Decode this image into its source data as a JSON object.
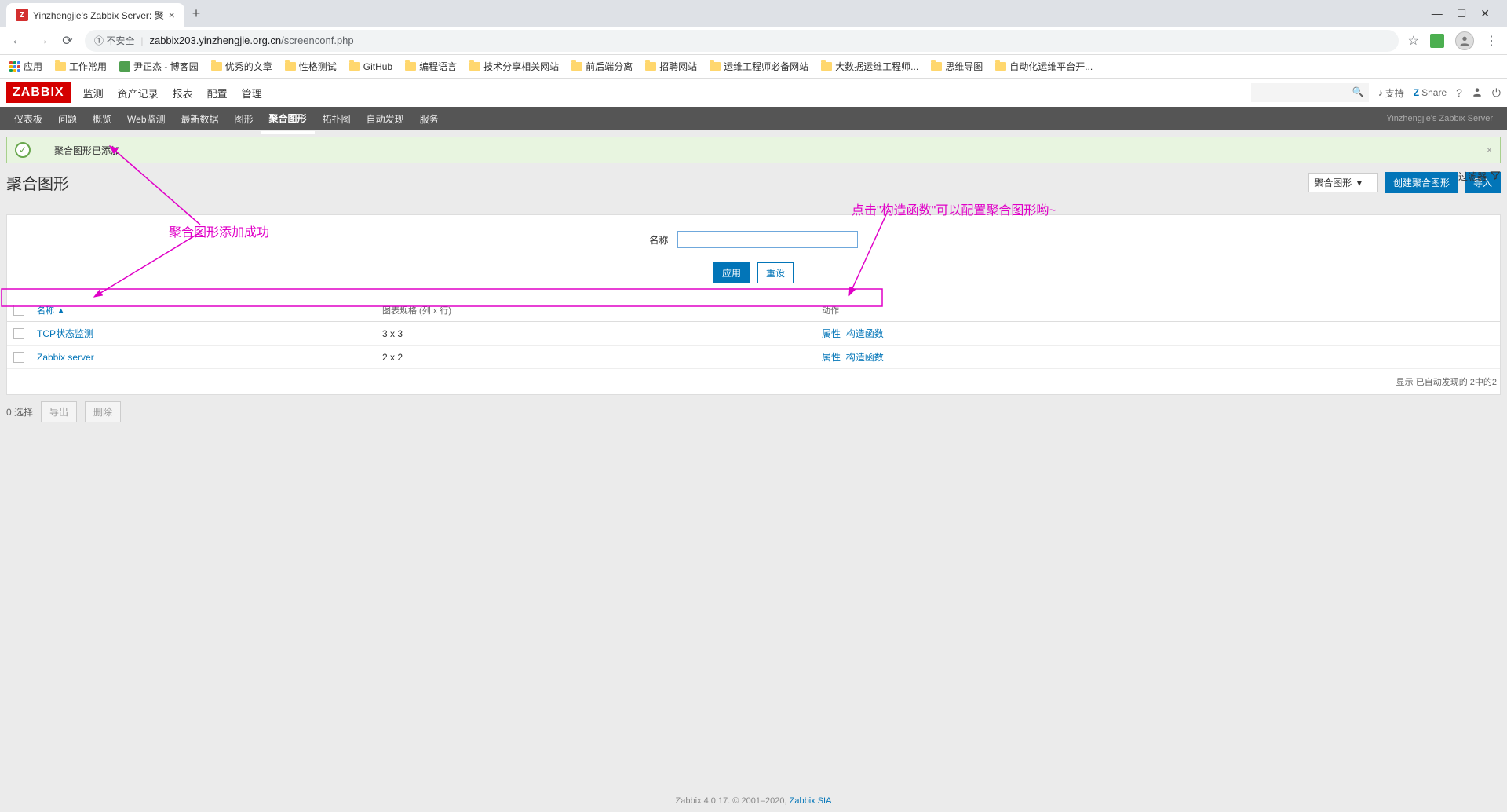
{
  "browser": {
    "tab_title": "Yinzhengjie's Zabbix Server: 聚",
    "favicon": "Z",
    "url_insecure_label": "① 不安全",
    "url_host": "zabbix203.yinzhengjie.org.cn",
    "url_path": "/screenconf.php",
    "bookmarks": {
      "apps": "应用",
      "items": [
        "工作常用",
        "尹正杰 - 博客园",
        "优秀的文章",
        "性格测试",
        "GitHub",
        "编程语言",
        "技术分享相关网站",
        "前后端分离",
        "招聘网站",
        "运维工程师必备网站",
        "大数据运维工程师...",
        "思维导图",
        "自动化运维平台开..."
      ]
    }
  },
  "zabbix": {
    "logo": "ZABBIX",
    "main_nav": [
      "监测",
      "资产记录",
      "报表",
      "配置",
      "管理"
    ],
    "sub_nav": [
      "仪表板",
      "问题",
      "概览",
      "Web监测",
      "最新数据",
      "图形",
      "聚合图形",
      "拓扑图",
      "自动发现",
      "服务"
    ],
    "active_sub_idx": 6,
    "server_label": "Yinzhengjie's Zabbix Server",
    "support": "支持",
    "share": "Share",
    "search_placeholder": ""
  },
  "message": {
    "text": "聚合图形已添加"
  },
  "page": {
    "title": "聚合图形",
    "type_select": "聚合图形",
    "create_btn": "创建聚合图形",
    "import_btn": "导入",
    "filter_toggle": "过滤器"
  },
  "filter": {
    "name_label": "名称",
    "name_value": "",
    "apply_btn": "应用",
    "reset_btn": "重设"
  },
  "table": {
    "cols": {
      "name": "名称",
      "sort": "▲",
      "size": "图表规格 (列 x 行)",
      "actions": "动作"
    },
    "rows": [
      {
        "name": "TCP状态监测",
        "size": "3 x 3",
        "actions": [
          "属性",
          "构造函数"
        ],
        "highlight": true
      },
      {
        "name": "Zabbix server",
        "size": "2 x 2",
        "actions": [
          "属性",
          "构造函数"
        ],
        "highlight": false
      }
    ],
    "footer": "显示 已自动发现的 2中的2"
  },
  "bottom": {
    "selected": "0 选择",
    "export_btn": "导出",
    "delete_btn": "删除"
  },
  "footer": {
    "text_prefix": "Zabbix 4.0.17. © 2001–2020, ",
    "link": "Zabbix SIA"
  },
  "annotations": {
    "a1": "聚合图形添加成功",
    "a2": "点击\"构造函数\"可以配置聚合图形哟~"
  }
}
